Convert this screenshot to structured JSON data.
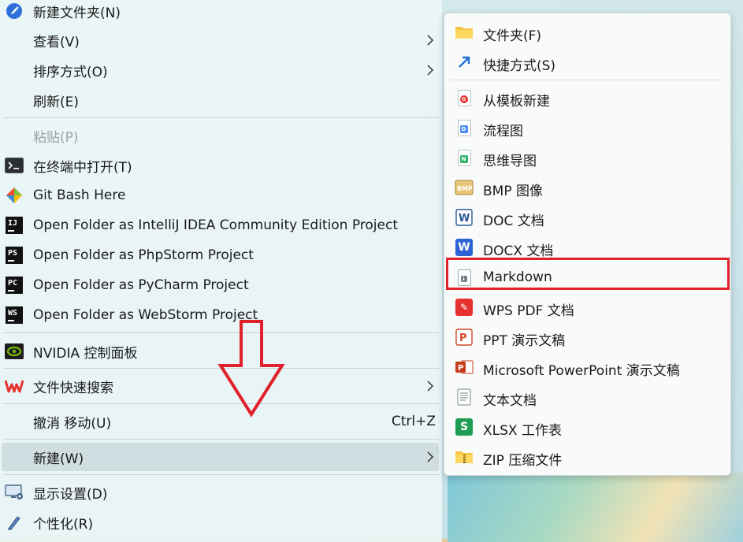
{
  "context_menu": {
    "items": [
      {
        "label": "新建文件夹(N)",
        "icon": "new-folder-icon"
      },
      {
        "label": "查看(V)",
        "submenu": true
      },
      {
        "label": "排序方式(O)",
        "submenu": true
      },
      {
        "label": "刷新(E)"
      },
      {
        "label": "粘贴(P)",
        "disabled": true
      },
      {
        "label": "在终端中打开(T)",
        "icon": "terminal-icon"
      },
      {
        "label": "Git Bash Here",
        "icon": "git-icon"
      },
      {
        "label": "Open Folder as IntelliJ IDEA Community Edition Project",
        "icon": "intellij-icon",
        "badge": "IJ"
      },
      {
        "label": "Open Folder as PhpStorm Project",
        "icon": "phpstorm-icon",
        "badge": "PS"
      },
      {
        "label": "Open Folder as PyCharm Project",
        "icon": "pycharm-icon",
        "badge": "PC"
      },
      {
        "label": "Open Folder as WebStorm Project",
        "icon": "webstorm-icon",
        "badge": "WS"
      },
      {
        "label": "NVIDIA 控制面板",
        "icon": "nvidia-icon"
      },
      {
        "label": "文件快速搜索",
        "icon": "wps-icon",
        "submenu": true
      },
      {
        "label": "撤消 移动(U)",
        "shortcut": "Ctrl+Z"
      },
      {
        "label": "新建(W)",
        "submenu": true,
        "hovered": true
      },
      {
        "label": "显示设置(D)",
        "icon": "display-settings-icon"
      },
      {
        "label": "个性化(R)",
        "icon": "personalize-icon"
      }
    ]
  },
  "new_submenu": {
    "items": [
      {
        "label": "文件夹(F)",
        "icon": "folder-icon"
      },
      {
        "label": "快捷方式(S)",
        "icon": "shortcut-icon"
      },
      {
        "label": "从模板新建",
        "icon": "template-icon"
      },
      {
        "label": "流程图",
        "icon": "flowchart-icon"
      },
      {
        "label": "思维导图",
        "icon": "mindmap-icon"
      },
      {
        "label": "BMP 图像",
        "icon": "bmp-icon"
      },
      {
        "label": "DOC 文档",
        "icon": "doc-icon"
      },
      {
        "label": "DOCX 文档",
        "icon": "docx-icon"
      },
      {
        "label": "Markdown",
        "icon": "markdown-icon",
        "highlighted": true
      },
      {
        "label": "WPS PDF 文档",
        "icon": "pdf-icon"
      },
      {
        "label": "PPT 演示文稿",
        "icon": "ppt-icon"
      },
      {
        "label": "Microsoft PowerPoint 演示文稿",
        "icon": "powerpoint-icon"
      },
      {
        "label": "文本文档",
        "icon": "text-doc-icon"
      },
      {
        "label": "XLSX 工作表",
        "icon": "xlsx-icon"
      },
      {
        "label": "ZIP 压缩文件",
        "icon": "zip-icon"
      }
    ]
  },
  "colors": {
    "highlight_border": "#e0202a",
    "annotation_arrow": "#e0202a",
    "menu_hover": "#bfcdd0"
  }
}
